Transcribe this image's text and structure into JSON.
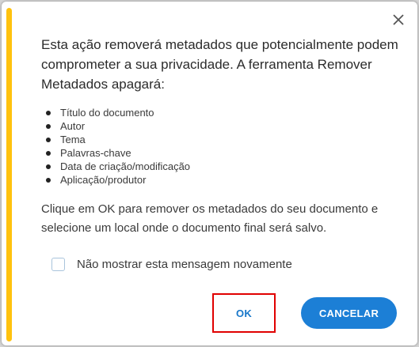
{
  "dialog": {
    "intro_text": "Esta ação removerá metadados que potencialmente podem comprometer a sua privacidade. A ferramenta Remover Metadados apagará:",
    "items": [
      "Título do documento",
      "Autor",
      "Tema",
      "Palavras-chave",
      "Data de criação/modificação",
      "Aplicação/produtor"
    ],
    "instruction_text": "Clique em OK para remover os metadados do seu documento e selecione um local onde o documento final será salvo.",
    "checkbox_label": "Não mostrar esta mensagem novamente",
    "checkbox_checked": false,
    "ok_label": "OK",
    "cancel_label": "CANCELAR",
    "close_icon": "close-icon"
  },
  "colors": {
    "accent": "#ffc20e",
    "primary": "#1c7fd6",
    "highlight": "#e00000"
  }
}
